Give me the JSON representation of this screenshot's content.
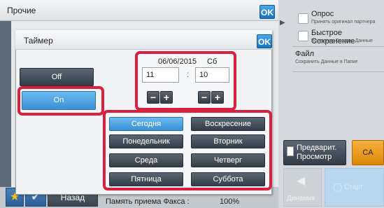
{
  "background": {
    "title": "Прочие",
    "ok_label": "OK",
    "back_label": "Назад",
    "fax_memory_label": "Память приема Факса :",
    "fax_memory_value": "100%"
  },
  "dialog": {
    "title": "Таймер",
    "ok_label": "OK",
    "off_label": "Off",
    "on_label": "On",
    "selected": "On",
    "date": "06/06/2015",
    "day_short": "Сб",
    "hour": "11",
    "minute": "10",
    "colon": ":",
    "minus": "−",
    "plus": "+",
    "days": {
      "today": "Сегодня",
      "sunday": "Воскресение",
      "monday": "Понедельник",
      "tuesday": "Вторник",
      "wednesday": "Среда",
      "thursday": "Четверг",
      "friday": "Пятница",
      "saturday": "Суббота"
    },
    "selected_day": "Сегодня"
  },
  "right_panel": {
    "opros_label": "Опрос",
    "opros_sub": "Принять оригинал партнера",
    "quick_label": "Быстрое Сохранение",
    "quick_sub": "Временно Сохран. Данные",
    "file_label": "Файл",
    "file_sub": "Сохранить Данные в Папке",
    "preview_label_1": "Предварит.",
    "preview_label_2": "Просмотр",
    "ca_label": "CA",
    "speaker_label": "Динамик",
    "start_label": "Старт"
  },
  "colors": {
    "highlight": "#d9203f",
    "selected_blue": "#3a8fd4",
    "ok_blue": "#1a74c3",
    "ca_orange": "#f6b13f"
  },
  "icons": [
    "star-icon",
    "check-icon",
    "collapse-arrow-icon",
    "preview-page-icon",
    "speaker-icon",
    "start-icon"
  ]
}
